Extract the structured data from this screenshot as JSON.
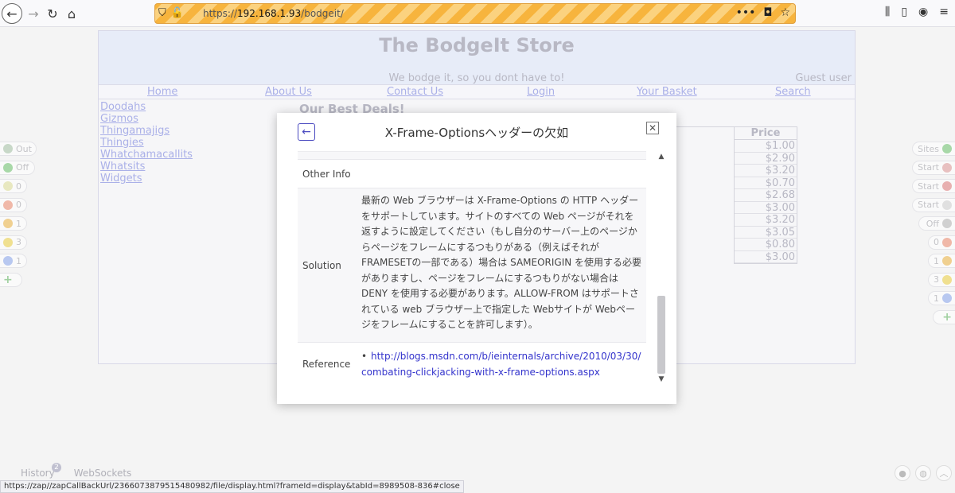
{
  "browser": {
    "url_prefix": "https://",
    "url_host": "192.168.1.93",
    "url_path": "/bodgeit/",
    "back_icon": "arrow-left-icon",
    "forward_icon": "arrow-right-icon",
    "reload_icon": "reload-icon",
    "home_icon": "home-icon",
    "menu_dots": "•••"
  },
  "store": {
    "title": "The BodgeIt Store",
    "subtitle": "We bodge it, so you dont have to!",
    "guest": "Guest user",
    "nav": [
      "Home",
      "About Us",
      "Contact Us",
      "Login",
      "Your Basket",
      "Search"
    ],
    "categories": [
      "Doodahs",
      "Gizmos",
      "Thingamajigs",
      "Thingies",
      "Whatchamacallits",
      "Whatsits",
      "Widgets"
    ],
    "deals_title": "Our Best Deals!",
    "price_header": "Price",
    "prices": [
      "$1.00",
      "$2.90",
      "$3.20",
      "$0.70",
      "$2.68",
      "$3.00",
      "$3.20",
      "$3.05",
      "$0.80",
      "$3.00"
    ]
  },
  "hud_left": [
    {
      "label": "Out",
      "color": "#c8d8c8"
    },
    {
      "label": "Off",
      "color": "#a8d8a8"
    },
    {
      "label": "0",
      "color": "#e8e8c0"
    },
    {
      "label": "0",
      "color": "#f0b8a8"
    },
    {
      "label": "1",
      "color": "#f0d090"
    },
    {
      "label": "3",
      "color": "#f0e090"
    },
    {
      "label": "1",
      "color": "#b8c8f0"
    },
    {
      "label": "+",
      "color": "#b8e0b8"
    }
  ],
  "hud_right": [
    {
      "label": "Sites",
      "color": "#a8d8a8"
    },
    {
      "label": "Start",
      "color": "#e8c0c0"
    },
    {
      "label": "Start",
      "color": "#e8b0b0"
    },
    {
      "label": "Start",
      "color": "#e0e0e0"
    },
    {
      "label": "Off",
      "color": "#d0d0d0"
    },
    {
      "label": "0",
      "color": "#f0b8a8"
    },
    {
      "label": "1",
      "color": "#f0d090"
    },
    {
      "label": "3",
      "color": "#f0e090"
    },
    {
      "label": "1",
      "color": "#b8c8f0"
    },
    {
      "label": "+",
      "color": "#b8e0b8"
    }
  ],
  "modal": {
    "title": "X-Frame-Optionsヘッダーの欠如",
    "rows": {
      "other_info_key": "Other Info",
      "solution_key": "Solution",
      "solution_value": "最新の Web ブラウザーは X-Frame-Options の HTTP ヘッダーをサポートしています。サイトのすべての Web ページがそれを返すように設定してください（もし自分のサーバー上のページからページをフレームにするつもりがある（例えばそれがFRAMESETの一部である）場合は SAMEORIGIN を使用する必要がありますし、ページをフレームにするつもりがない場合は DENY を使用する必要があります。ALLOW-FROM はサポートされている web ブラウザー上で指定した Webサイトが Webページをフレームにすることを許可します）。",
      "reference_key": "Reference",
      "reference_link": "http://blogs.msdn.com/b/ieinternals/archive/2010/03/30/combating-clickjacking-with-x-frame-options.aspx"
    }
  },
  "bottom": {
    "history_tab": "History",
    "history_badge": "2",
    "websockets_tab": "WebSockets",
    "status_url": "https://zap//zapCallBackUrl/2366073879515480982/file/display.html?frameId=display&tabId=8989508-836#close"
  }
}
